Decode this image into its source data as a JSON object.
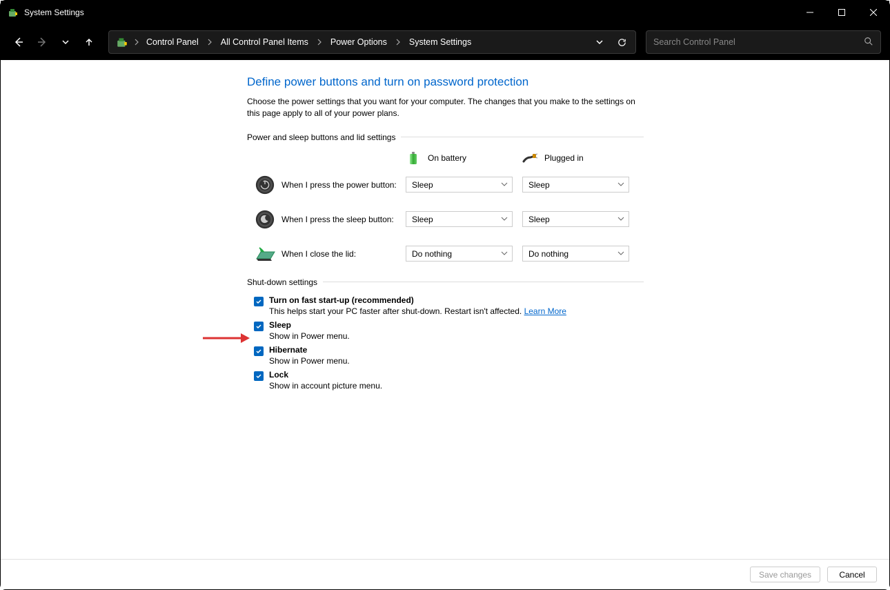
{
  "window": {
    "title": "System Settings"
  },
  "breadcrumb": {
    "items": [
      "Control Panel",
      "All Control Panel Items",
      "Power Options",
      "System Settings"
    ]
  },
  "search": {
    "placeholder": "Search Control Panel"
  },
  "page": {
    "title": "Define power buttons and turn on password protection",
    "description": "Choose the power settings that you want for your computer. The changes that you make to the settings on this page apply to all of your power plans."
  },
  "section1": {
    "title": "Power and sleep buttons and lid settings",
    "cols": {
      "battery": "On battery",
      "plugged": "Plugged in"
    },
    "rows": [
      {
        "label": "When I press the power button:",
        "battery": "Sleep",
        "plugged": "Sleep"
      },
      {
        "label": "When I press the sleep button:",
        "battery": "Sleep",
        "plugged": "Sleep"
      },
      {
        "label": "When I close the lid:",
        "battery": "Do nothing",
        "plugged": "Do nothing"
      }
    ]
  },
  "section2": {
    "title": "Shut-down settings",
    "items": [
      {
        "label": "Turn on fast start-up (recommended)",
        "desc": "This helps start your PC faster after shut-down. Restart isn't affected. ",
        "link": "Learn More"
      },
      {
        "label": "Sleep",
        "desc": "Show in Power menu."
      },
      {
        "label": "Hibernate",
        "desc": "Show in Power menu."
      },
      {
        "label": "Lock",
        "desc": "Show in account picture menu."
      }
    ]
  },
  "footer": {
    "save": "Save changes",
    "cancel": "Cancel"
  }
}
